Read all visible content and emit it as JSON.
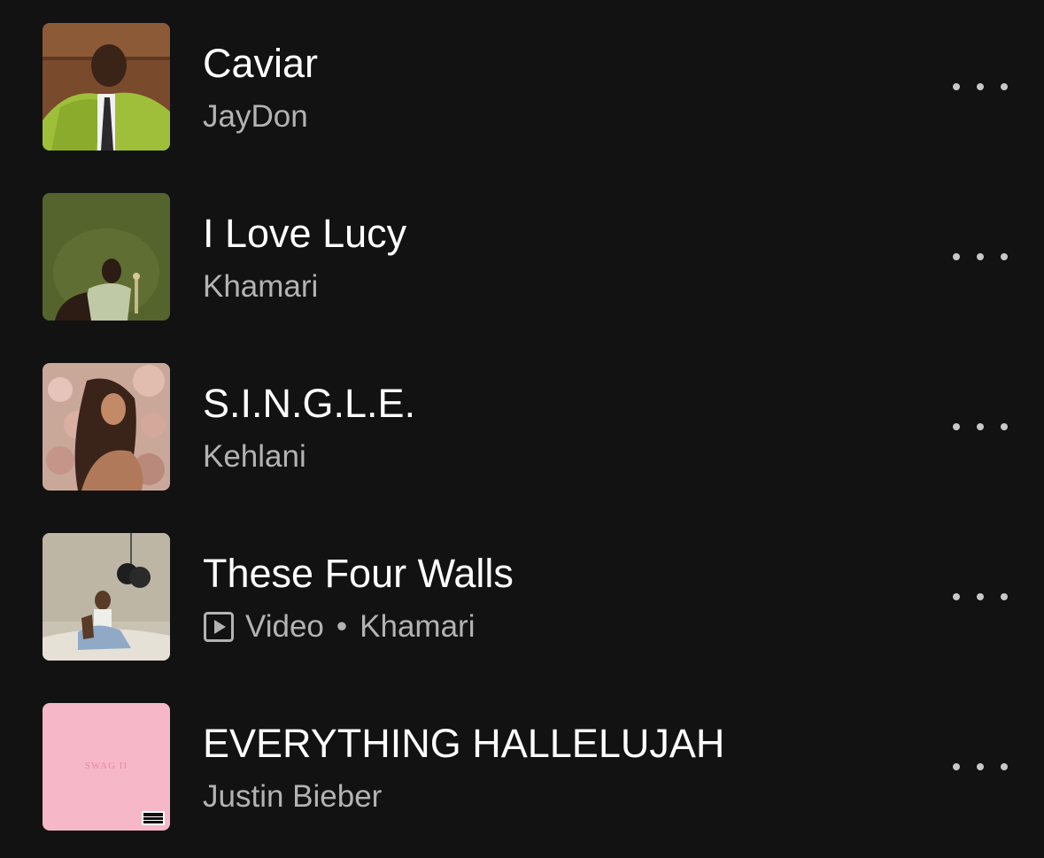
{
  "tracks": [
    {
      "title": "Caviar",
      "artist": "JayDon",
      "art_icon": "album-art-caviar"
    },
    {
      "title": "I Love Lucy",
      "artist": "Khamari",
      "art_icon": "album-art-i-love-lucy"
    },
    {
      "title": "S.I.N.G.L.E.",
      "artist": "Kehlani",
      "art_icon": "album-art-single"
    },
    {
      "title": "These Four Walls",
      "type": "Video",
      "separator": "•",
      "artist": "Khamari",
      "art_icon": "album-art-these-four-walls"
    },
    {
      "title": "EVERYTHING HALLELUJAH",
      "artist": "Justin Bieber",
      "art_icon": "album-art-swag-ii",
      "art_text": "SWAG II"
    }
  ],
  "colors": {
    "background": "#121212",
    "title": "#ffffff",
    "subtitle": "#b3b3b3",
    "more_dots": "#c8c8c8"
  }
}
